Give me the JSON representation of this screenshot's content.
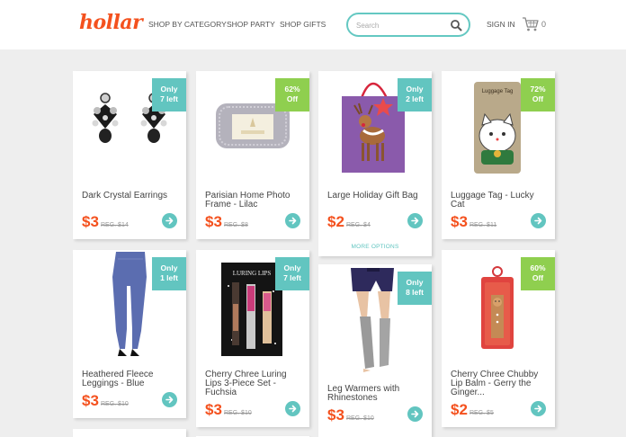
{
  "header": {
    "logo": "hollar",
    "nav": [
      "SHOP BY CATEGORY",
      "SHOP PARTY",
      "SHOP GIFTS"
    ],
    "search_placeholder": "Search",
    "signin": "SIGN IN",
    "cart_count": "0"
  },
  "products": [
    {
      "title": "Dark Crystal Earrings",
      "price": "$3",
      "reg": "REG. $14",
      "badge_l1": "Only",
      "badge_l2": "7 left",
      "badge_color": "#62c5c0"
    },
    {
      "title": "Parisian Home Photo Frame - Lilac",
      "price": "$3",
      "reg": "REG. $8",
      "badge_l1": "62%",
      "badge_l2": "Off",
      "badge_color": "#8fcf4f"
    },
    {
      "title": "Large Holiday Gift Bag",
      "price": "$2",
      "reg": "REG. $4",
      "badge_l1": "Only",
      "badge_l2": "2 left",
      "badge_color": "#62c5c0",
      "more": "MORE OPTIONS"
    },
    {
      "title": "Luggage Tag - Lucky Cat",
      "price": "$3",
      "reg": "REG. $11",
      "badge_l1": "72%",
      "badge_l2": "Off",
      "badge_color": "#8fcf4f",
      "img_label": "Luggage Tag"
    },
    {
      "title": "Heathered Fleece Leggings - Blue",
      "price": "$3",
      "reg": "REG. $10",
      "badge_l1": "Only",
      "badge_l2": "1 left",
      "badge_color": "#62c5c0"
    },
    {
      "title": "Cherry Chree Luring Lips 3-Piece Set - Fuchsia",
      "price": "$3",
      "reg": "REG. $10",
      "badge_l1": "Only",
      "badge_l2": "7 left",
      "badge_color": "#62c5c0",
      "img_label": "LURING LIPS"
    },
    {
      "title": "Leg Warmers with Rhinestones",
      "price": "$3",
      "reg": "REG. $10",
      "badge_l1": "Only",
      "badge_l2": "8 left",
      "badge_color": "#62c5c0"
    },
    {
      "title": "Cherry Chree Chubby Lip Balm - Gerry the Ginger...",
      "price": "$2",
      "reg": "REG. $5",
      "badge_l1": "60%",
      "badge_l2": "Off",
      "badge_color": "#8fcf4f"
    }
  ]
}
